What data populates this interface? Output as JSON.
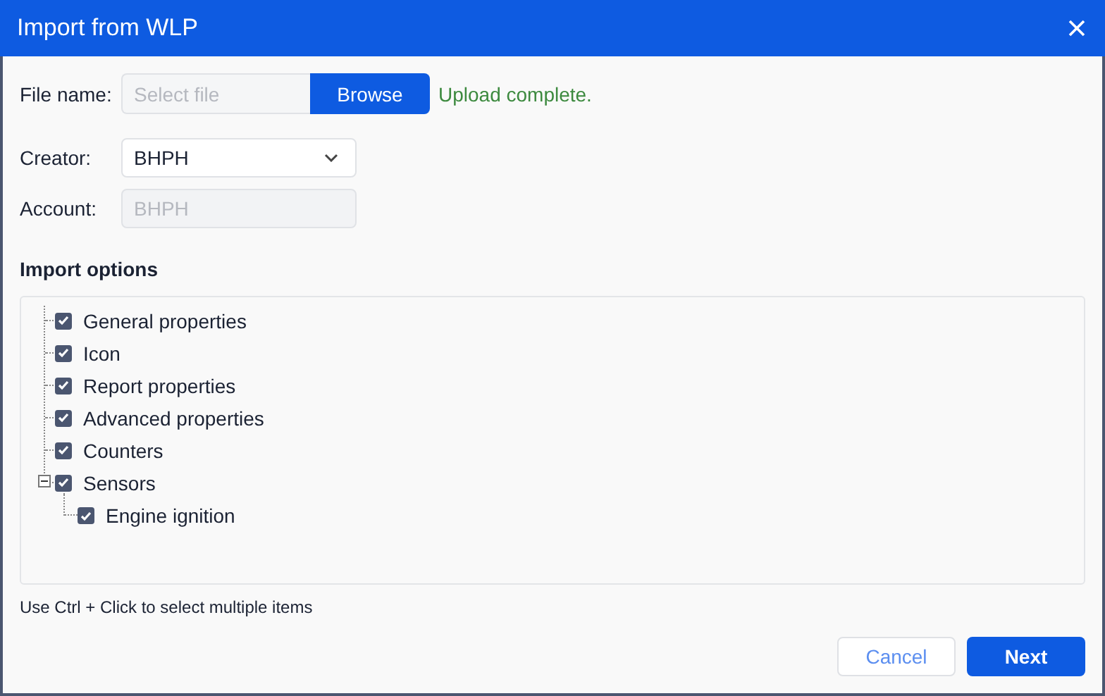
{
  "window": {
    "title": "Import from WLP"
  },
  "file_name": {
    "label": "File name:",
    "placeholder": "Select file",
    "button": "Browse",
    "status": "Upload complete."
  },
  "creator": {
    "label": "Creator:",
    "value": "BHPH"
  },
  "account": {
    "label": "Account:",
    "value": "BHPH",
    "disabled": true
  },
  "import_options": {
    "title": "Import options",
    "items": [
      {
        "label": "General properties",
        "checked": true
      },
      {
        "label": "Icon",
        "checked": true
      },
      {
        "label": "Report properties",
        "checked": true
      },
      {
        "label": "Advanced properties",
        "checked": true
      },
      {
        "label": "Counters",
        "checked": true
      },
      {
        "label": "Sensors",
        "checked": true,
        "expanded": true,
        "children": [
          {
            "label": "Engine ignition",
            "checked": true
          }
        ]
      }
    ]
  },
  "hint": "Use Ctrl + Click to select multiple items",
  "buttons": [
    {
      "label": "Cancel",
      "kind": "secondary"
    },
    {
      "label": "Next",
      "kind": "primary"
    }
  ]
}
